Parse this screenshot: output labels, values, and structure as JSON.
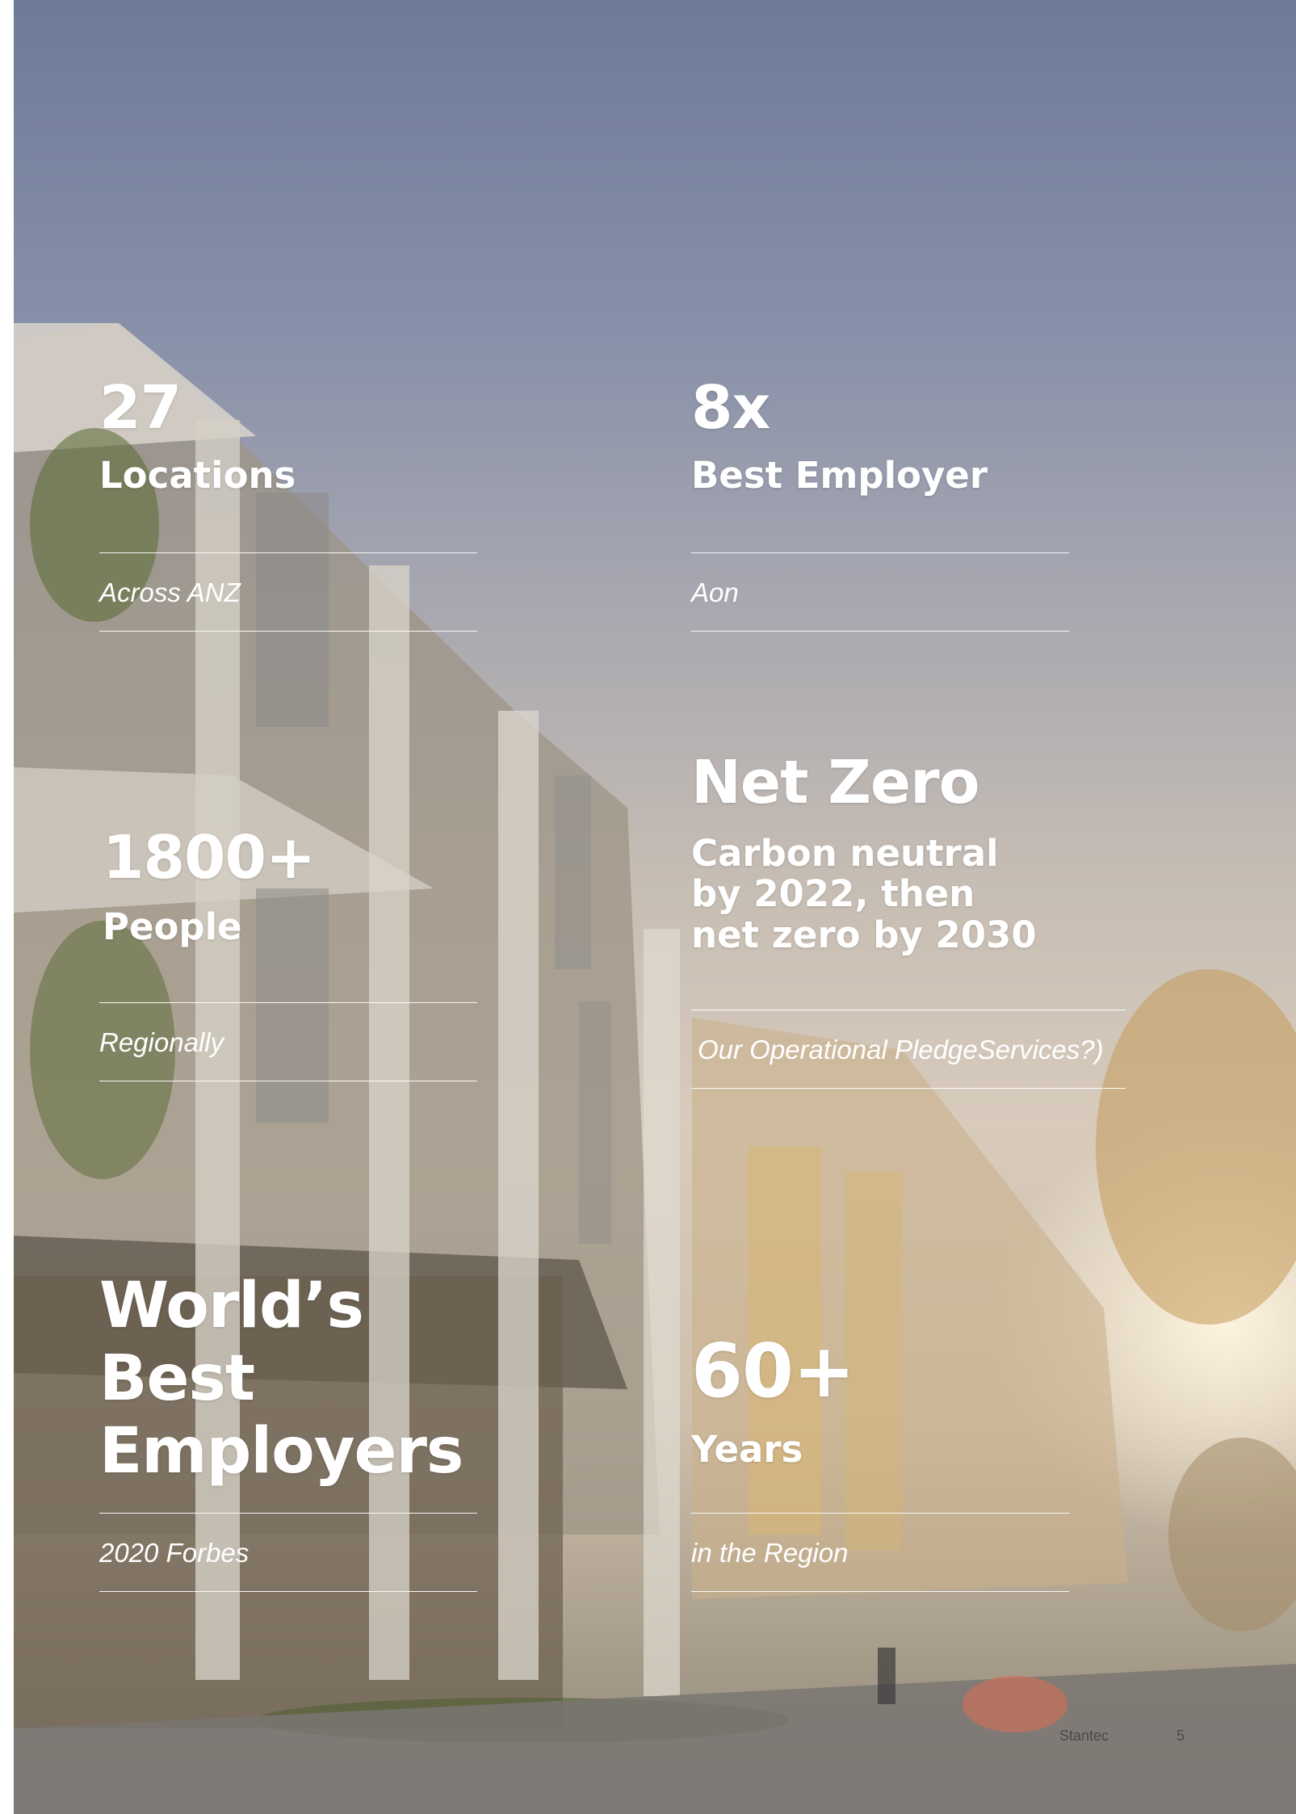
{
  "stats": {
    "locations": {
      "value": "27",
      "label": "Locations",
      "sub": "Across ANZ"
    },
    "best_employer": {
      "value": "8x",
      "label": "Best Employer",
      "sub": "Aon"
    },
    "people": {
      "value": "1800+",
      "label": "People",
      "sub": "Regionally"
    },
    "net_zero": {
      "value": "Net Zero",
      "label_lines": [
        "Carbon neutral",
        "by 2022, then",
        "net zero by 2030"
      ],
      "sub": "Our Operational PledgeServices?)"
    },
    "worlds_best": {
      "value_lines": [
        "World’s",
        "Best",
        "Employers"
      ],
      "sub": "2020 Forbes"
    },
    "years": {
      "value": "60+",
      "label": "Years",
      "sub": "in the Region"
    }
  },
  "footer": {
    "brand": "Stantec",
    "page_number": "5"
  }
}
